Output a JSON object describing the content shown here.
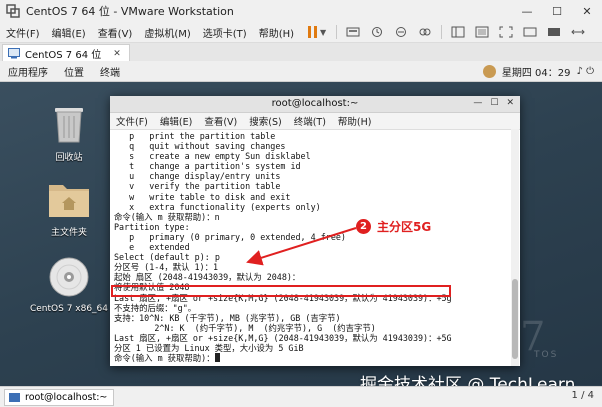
{
  "window": {
    "title": "CentOS 7 64 位 - VMware Workstation",
    "controls": [
      "—",
      "☐",
      "✕"
    ]
  },
  "menubar": {
    "items": [
      "文件(F)",
      "编辑(E)",
      "查看(V)",
      "虚拟机(M)",
      "选项卡(T)",
      "帮助(H)"
    ]
  },
  "tab": {
    "label": "CentOS 7 64 位",
    "close": "✕"
  },
  "gnome": {
    "menus": [
      "应用程序",
      "位置",
      "终端"
    ],
    "clock": "星期四 04：29",
    "sys": "♪ ⏻"
  },
  "desktop": {
    "icons": [
      {
        "label": "回收站",
        "icon": "trash-icon"
      },
      {
        "label": "主文件夹",
        "icon": "home-folder-icon"
      },
      {
        "label": "CentOS 7 x86_64",
        "icon": "dvd-icon"
      }
    ],
    "watermark_numeral": "7",
    "watermark_text": "TOS"
  },
  "terminal": {
    "title": "root@localhost:~",
    "controls": [
      "—",
      "☐",
      "✕"
    ],
    "menus": [
      "文件(F)",
      "编辑(E)",
      "查看(V)",
      "搜索(S)",
      "终端(T)",
      "帮助(H)"
    ],
    "lines": [
      "   p   print the partition table",
      "   q   quit without saving changes",
      "   s   create a new empty Sun disklabel",
      "   t   change a partition's system id",
      "   u   change display/entry units",
      "   v   verify the partition table",
      "   w   write table to disk and exit",
      "   x   extra functionality (experts only)",
      "",
      "命令(输入 m 获取帮助)：n",
      "Partition type:",
      "   p   primary (0 primary, 0 extended, 4 free)",
      "   e   extended",
      "Select (default p): p",
      "分区号 (1-4，默认 1)：1",
      "起始 扇区 (2048-41943039，默认为 2048)：",
      "将使用默认值 2048",
      "Last 扇区, +扇区 or +size{K,M,G} (2048-41943039，默认为 41943039)：+5g",
      "不支持的后缀：\"g\"。",
      "支持：10^N: KB (千字节), MB (兆字节), GB (吉字节)",
      "        2^N: K  (约千字节), M  (约兆字节), G  (约吉字节)",
      "Last 扇区, +扇区 or +size{K,M,G} (2048-41943039，默认为 41943039)：+5G",
      "分区 1 已设置为 Linux 类型，大小设为 5 GiB",
      "",
      "命令(输入 m 获取帮助)："
    ]
  },
  "annotation": {
    "badge": "2",
    "text": "主分区5G",
    "color": "#e02020"
  },
  "site_watermark": "掘金技术社区 @ TechLearn",
  "taskbar": {
    "item": "root@localhost:~",
    "pager": "1 / 4"
  }
}
